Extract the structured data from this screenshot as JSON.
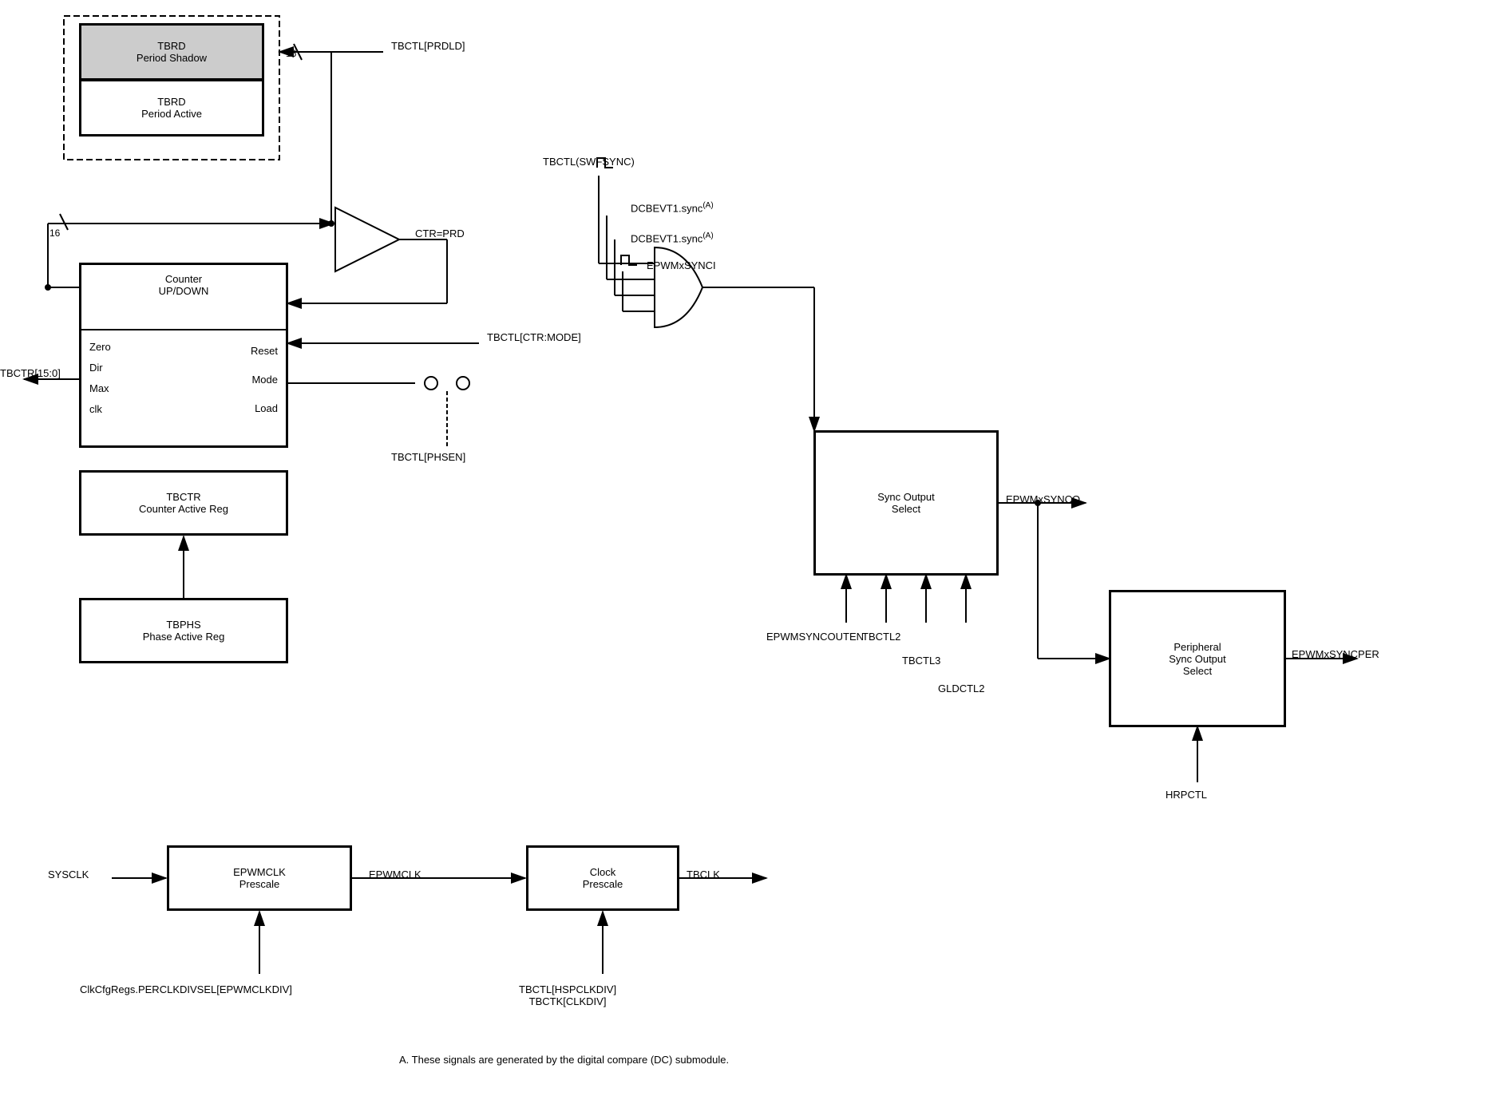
{
  "boxes": {
    "tbrd_shadow": {
      "label_line1": "TBRD",
      "label_line2": "Period Shadow"
    },
    "tbrd_active": {
      "label_line1": "TBRD",
      "label_line2": "Period Active"
    },
    "counter": {
      "label_line1": "Counter",
      "label_line2": "UP/DOWN"
    },
    "tbctr": {
      "label_line1": "TBCTR",
      "label_line2": "Counter Active Reg"
    },
    "tbphs": {
      "label_line1": "TBPHS",
      "label_line2": "Phase Active Reg"
    },
    "sync_output_select": {
      "label_line1": "Sync Output",
      "label_line2": "Select"
    },
    "peripheral_sync": {
      "label_line1": "Peripheral",
      "label_line2": "Sync Output",
      "label_line3": "Select"
    },
    "epwmclk_prescale": {
      "label_line1": "EPWMCLK",
      "label_line2": "Prescale"
    },
    "clock_prescale": {
      "label_line1": "Clock",
      "label_line2": "Prescale"
    }
  },
  "signals": {
    "tbctl_prdld": "TBCTL[PRDLD]",
    "tbctr_15_0": "TBCTR[15:0]",
    "ctr_prd": "CTR=PRD",
    "tbctl_swfsync": "TBCTL(SWFSYNC)",
    "dcbevt1_sync_1": "DCBEVT1.sync",
    "dcbevt1_sync_2": "DCBEVT1.sync",
    "epwmxsynci": "EPWMxSYNCI",
    "tbctl_ctr_mode": "TBCTL[CTR:MODE]",
    "tbctl_phsen": "TBCTL[PHSEN]",
    "epwmsyncouten": "EPWMSYNCOUTEN",
    "tbctl2": "TBCTL2",
    "tbctl3": "TBCTL3",
    "gldctl2": "GLDCTL2",
    "epwmxsynco": "EPWMxSYNCO",
    "epwmxsyncper": "EPWMxSYNCPER",
    "hrpctl": "HRPCTL",
    "sysclk": "SYSCLK",
    "epwmclk": "EPWMCLK",
    "tbclk": "TBCLK",
    "clkcfgregs": "ClkCfgRegs.PERCLKDIVSEL[EPWMCLKDIV]",
    "tbctl_hspclkdiv": "TBCTL[HSPCLKDIV]",
    "tbctk_clkdiv": "TBCTK[CLKDIV]",
    "counter_labels": [
      "Zero",
      "Dir",
      "Max",
      "clk"
    ],
    "counter_right_labels": [
      "Reset",
      "Mode",
      "Load"
    ],
    "footnote": "A. These signals are generated by the digital compare (DC) submodule.",
    "a_superscript": "(A)"
  }
}
